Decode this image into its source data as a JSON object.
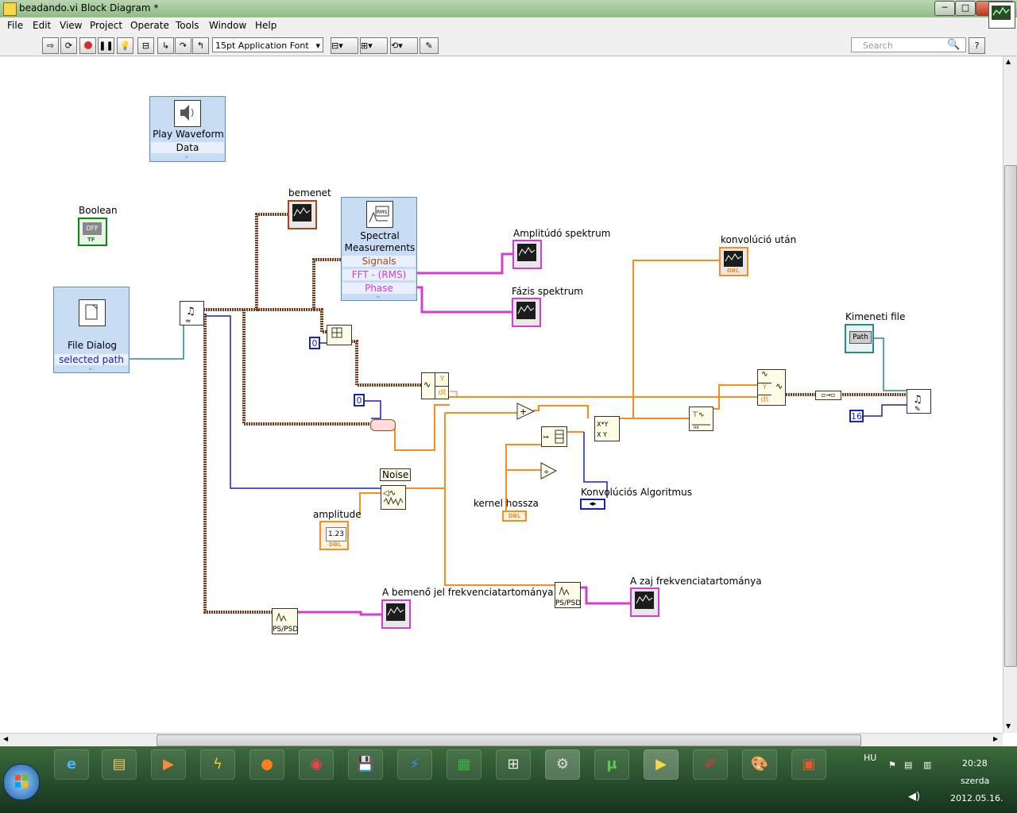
{
  "window": {
    "title": "beadando.vi Block Diagram *",
    "minimize": "─",
    "maximize": "□",
    "close": "✕"
  },
  "menu": [
    "File",
    "Edit",
    "View",
    "Project",
    "Operate",
    "Tools",
    "Window",
    "Help"
  ],
  "toolbar": {
    "font": "15pt Application Font",
    "search_placeholder": "Search",
    "help": "?"
  },
  "diagram": {
    "play_waveform": {
      "title": "Play Waveform",
      "term": "Data"
    },
    "boolean": {
      "label": "Boolean",
      "value": "OFF",
      "type": "TF"
    },
    "file_dialog": {
      "title": "File Dialog",
      "term": "selected path"
    },
    "bemenet": {
      "label": "bemenet"
    },
    "spectral": {
      "title": "Spectral\nMeasurements",
      "terms": [
        "Signals",
        "FFT - (RMS)",
        "Phase"
      ]
    },
    "amplitudo_spektrum": {
      "label": "Amplitúdó spektrum"
    },
    "fazis_spektrum": {
      "label": "Fázis spektrum"
    },
    "konvolucio_utan": {
      "label": "konvolúció után",
      "type": "DBL"
    },
    "kimeneti_file": {
      "label": "Kimeneti file",
      "value": "Path"
    },
    "const_0a": "0",
    "const_0b": "0",
    "const_16": "16",
    "noise": {
      "label": "Noise"
    },
    "amplitude": {
      "label": "amplitude",
      "value": "1.23",
      "type": "DBL"
    },
    "kernel_hossza": {
      "label": "kernel hossza",
      "type": "DBL"
    },
    "konvolucios": {
      "label": "Konvolúciós Algoritmus"
    },
    "bemeno_freq": {
      "label": "A bemenő jel frekvenciatartománya"
    },
    "zaj_freq": {
      "label": "A zaj frekvenciatartománya"
    },
    "ps_psd": "PS/PSD",
    "y": "Y",
    "dt": "dt"
  },
  "taskbar": {
    "language": "HU",
    "time": "20:28",
    "day": "szerda",
    "date": "2012.05.16."
  },
  "colors": {
    "wire_waveform": "#7b3a1c",
    "wire_dbl": "#ff8c1a",
    "wire_int": "#1a22b4",
    "wire_cluster": "#d43cd4",
    "wire_path": "#2a8a8a",
    "wire_bool": "#0a8a0a"
  }
}
